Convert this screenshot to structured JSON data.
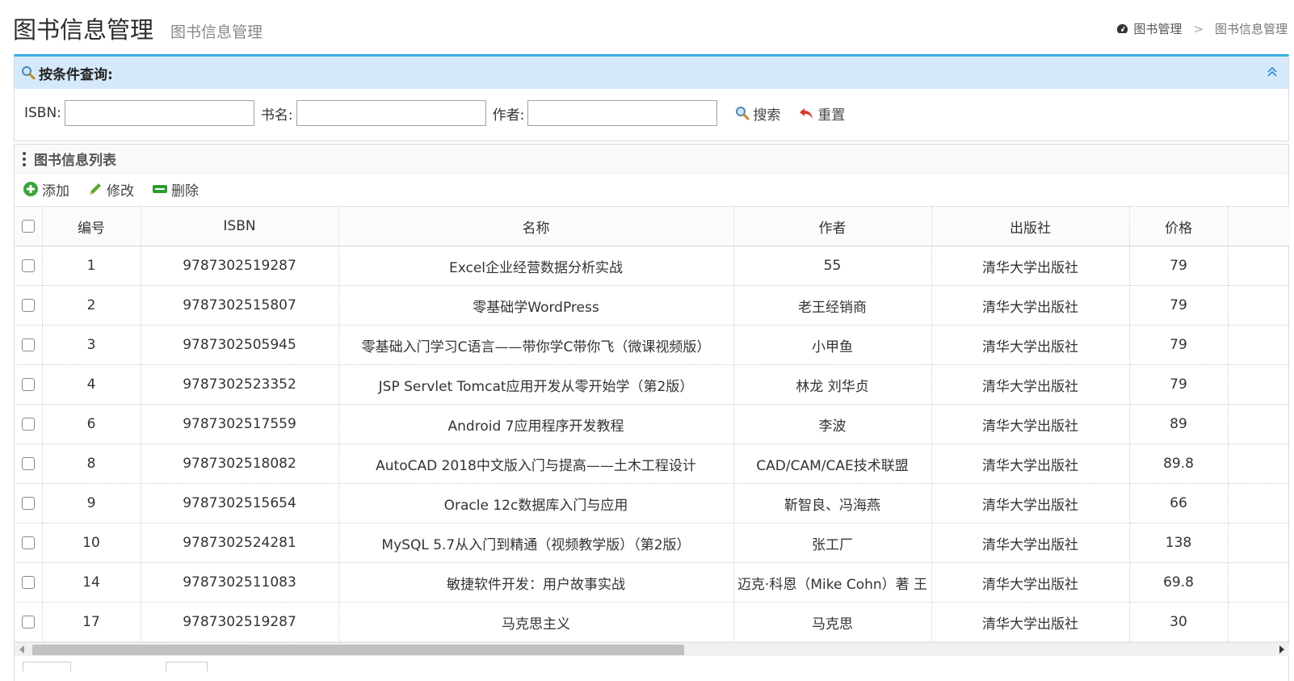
{
  "header": {
    "title": "图书信息管理",
    "subtitle": "图书信息管理",
    "breadcrumb": {
      "root": "图书管理",
      "separator": ">",
      "current": "图书信息管理"
    }
  },
  "query": {
    "title": "按条件查询:",
    "fields": [
      {
        "label": "ISBN:",
        "value": "",
        "placeholder": ""
      },
      {
        "label": "书名:",
        "value": "",
        "placeholder": ""
      },
      {
        "label": "作者:",
        "value": "",
        "placeholder": ""
      }
    ],
    "search_label": "搜索",
    "reset_label": "重置"
  },
  "list": {
    "title": "图书信息列表",
    "toolbar": {
      "add_label": "添加",
      "edit_label": "修改",
      "delete_label": "删除"
    },
    "columns": [
      "编号",
      "ISBN",
      "名称",
      "作者",
      "出版社",
      "价格"
    ],
    "rows": [
      {
        "id": "1",
        "isbn": "9787302519287",
        "name": "Excel企业经营数据分析实战",
        "author": "55",
        "publisher": "清华大学出版社",
        "price": "79"
      },
      {
        "id": "2",
        "isbn": "9787302515807",
        "name": "零基础学WordPress",
        "author": "老王经销商",
        "publisher": "清华大学出版社",
        "price": "79"
      },
      {
        "id": "3",
        "isbn": "9787302505945",
        "name": "零基础入门学习C语言——带你学C带你飞（微课视频版）",
        "author": "小甲鱼",
        "publisher": "清华大学出版社",
        "price": "79"
      },
      {
        "id": "4",
        "isbn": "9787302523352",
        "name": "JSP Servlet Tomcat应用开发从零开始学（第2版）",
        "author": "林龙 刘华贞",
        "publisher": "清华大学出版社",
        "price": "79"
      },
      {
        "id": "6",
        "isbn": "9787302517559",
        "name": "Android 7应用程序开发教程",
        "author": "李波",
        "publisher": "清华大学出版社",
        "price": "89"
      },
      {
        "id": "8",
        "isbn": "9787302518082",
        "name": "AutoCAD 2018中文版入门与提高——土木工程设计",
        "author": "CAD/CAM/CAE技术联盟",
        "publisher": "清华大学出版社",
        "price": "89.8"
      },
      {
        "id": "9",
        "isbn": "9787302515654",
        "name": "Oracle 12c数据库入门与应用",
        "author": "靳智良、冯海燕",
        "publisher": "清华大学出版社",
        "price": "66"
      },
      {
        "id": "10",
        "isbn": "9787302524281",
        "name": "MySQL 5.7从入门到精通（视频教学版）（第2版）",
        "author": "张工厂",
        "publisher": "清华大学出版社",
        "price": "138"
      },
      {
        "id": "14",
        "isbn": "9787302511083",
        "name": "敏捷软件开发：用户故事实战",
        "author": "迈克·科恩（Mike Cohn）著  王",
        "publisher": "清华大学出版社",
        "price": "69.8"
      },
      {
        "id": "17",
        "isbn": "9787302519287",
        "name": "马克思主义",
        "author": "马克思",
        "publisher": "清华大学出版社",
        "price": "30"
      }
    ]
  },
  "colors": {
    "accent": "#3ab0e2",
    "query_header_bg": "#d6e9fb"
  }
}
